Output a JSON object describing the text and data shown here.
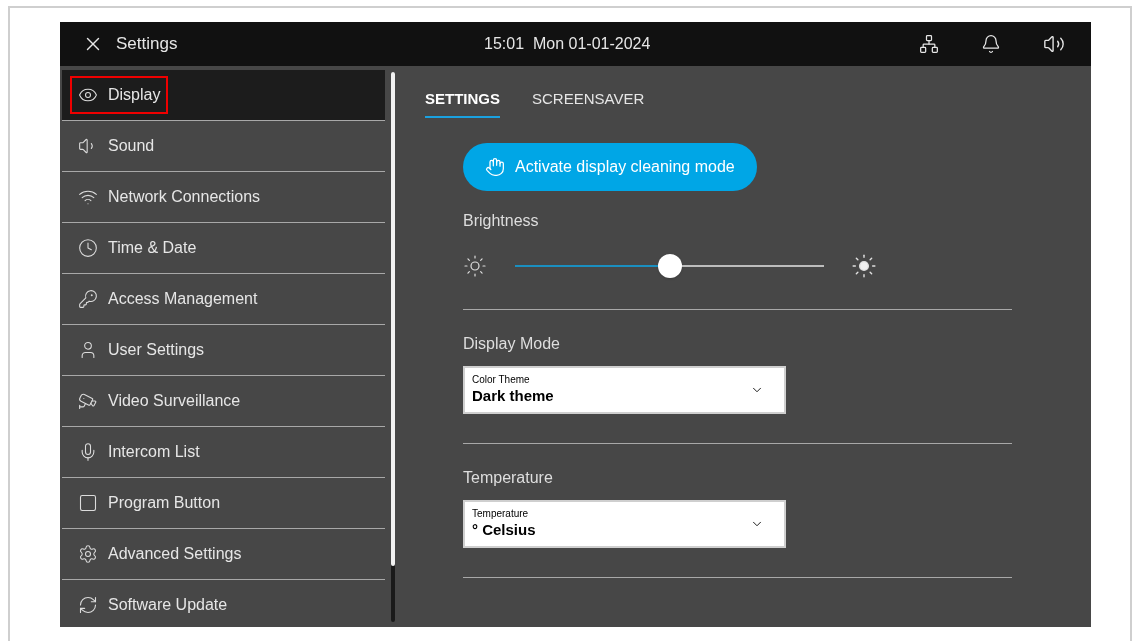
{
  "header": {
    "title": "Settings",
    "datetime": "15:01  Mon 01-01-2024"
  },
  "sidebar": {
    "items": [
      {
        "label": "Display",
        "selected": true,
        "highlighted": true
      },
      {
        "label": "Sound",
        "selected": false,
        "highlighted": false
      },
      {
        "label": "Network Connections",
        "selected": false,
        "highlighted": false
      },
      {
        "label": "Time & Date",
        "selected": false,
        "highlighted": false
      },
      {
        "label": "Access Management",
        "selected": false,
        "highlighted": false
      },
      {
        "label": "User Settings",
        "selected": false,
        "highlighted": false
      },
      {
        "label": "Video Surveillance",
        "selected": false,
        "highlighted": false
      },
      {
        "label": "Intercom List",
        "selected": false,
        "highlighted": false
      },
      {
        "label": "Program Button",
        "selected": false,
        "highlighted": false
      },
      {
        "label": "Advanced Settings",
        "selected": false,
        "highlighted": false
      },
      {
        "label": "Software Update",
        "selected": false,
        "highlighted": false
      }
    ]
  },
  "tabs": [
    {
      "label": "SETTINGS",
      "selected": true
    },
    {
      "label": "SCREENSAVER",
      "selected": false
    }
  ],
  "cleaning_button": "Activate display cleaning mode",
  "brightness": {
    "label": "Brightness",
    "level": 0.5
  },
  "sections": [
    {
      "title": "Display Mode",
      "field_label": "Color Theme",
      "value": "Dark theme"
    },
    {
      "title": "Temperature",
      "field_label": "Temperature",
      "value": "° Celsius"
    }
  ]
}
